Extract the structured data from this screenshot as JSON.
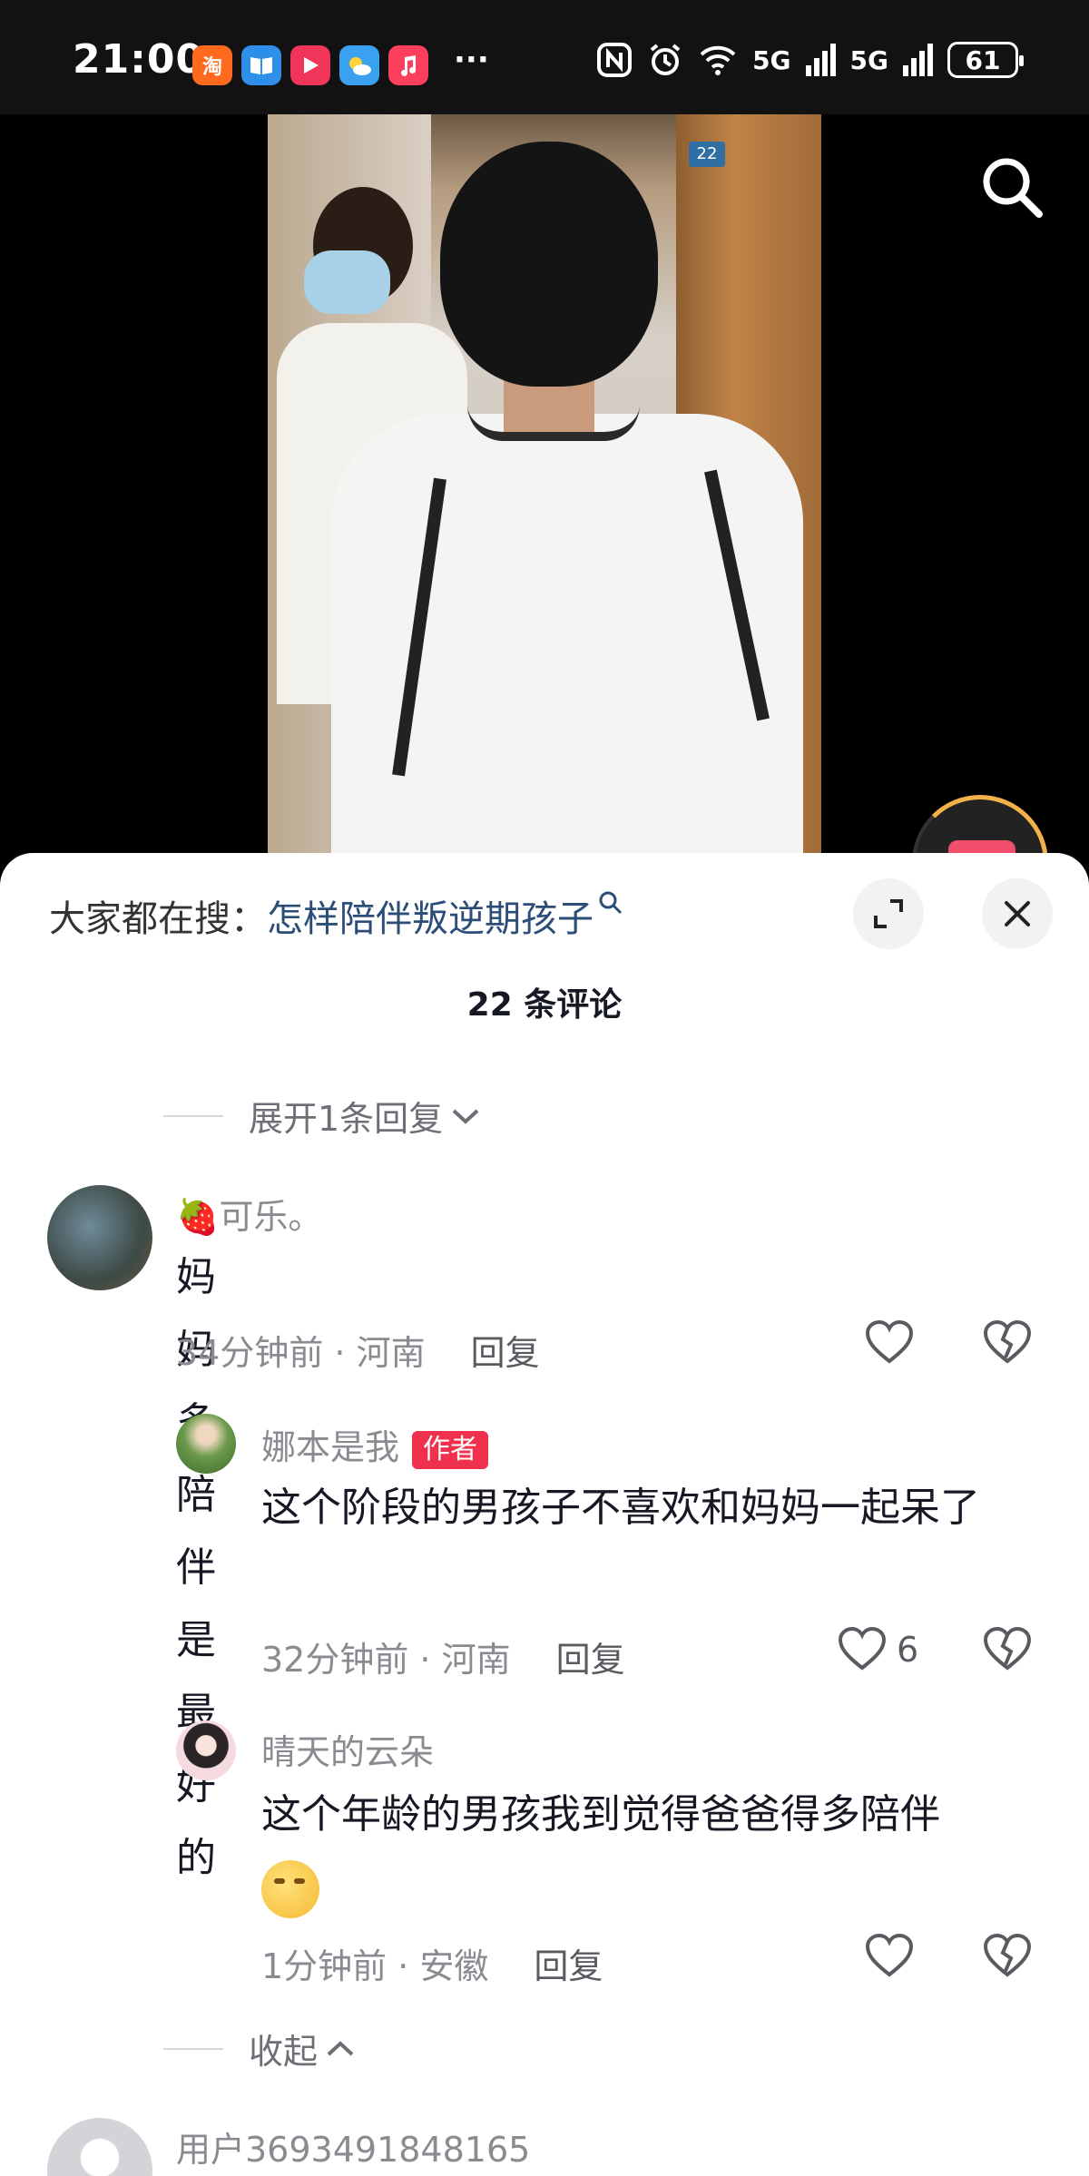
{
  "status_bar": {
    "time": "21:00",
    "app_icons": [
      "taobao-icon",
      "book-icon",
      "video-icon",
      "weather-icon",
      "music-icon"
    ],
    "more": "···",
    "network_1": "5G",
    "network_2": "5G",
    "battery": "61"
  },
  "video": {
    "door_number": "22"
  },
  "sheet": {
    "search_prefix": "大家都在搜：",
    "search_query": "怎样陪伴叛逆期孩子",
    "comment_count_title": "22 条评论",
    "expand_replies": "展开1条回复",
    "collapse_replies": "收起",
    "comments": [
      {
        "name": "可乐。",
        "name_prefix_emoji": "🍓",
        "text": "妈妈多陪伴是最好的",
        "time_location": "34分钟前 · 河南",
        "reply_label": "回复",
        "likes": ""
      },
      {
        "name": "娜本是我",
        "badge": "作者",
        "text": "这个阶段的男孩子不喜欢和妈妈一起呆了",
        "time_location": "32分钟前 · 河南",
        "reply_label": "回复",
        "likes": "6"
      },
      {
        "name": "晴天的云朵",
        "text": "这个年龄的男孩我到觉得爸爸得多陪伴",
        "time_location": "1分钟前 · 安徽",
        "reply_label": "回复",
        "likes": ""
      },
      {
        "name": "用户3693491848165"
      }
    ]
  },
  "colors": {
    "accent_red": "#f0314e",
    "search_link": "#2b4d78",
    "meta_gray": "#8a8b91"
  }
}
